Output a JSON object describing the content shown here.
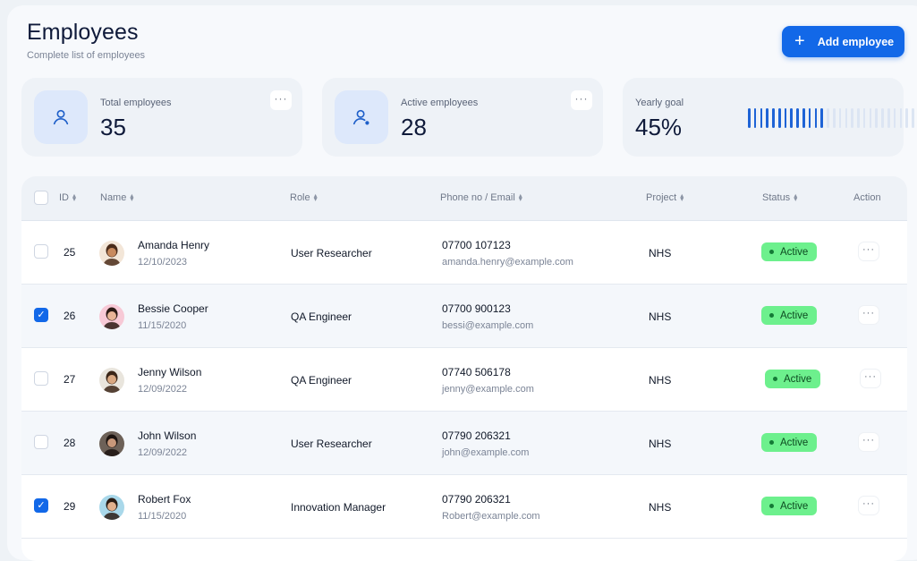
{
  "header": {
    "title": "Employees",
    "subtitle": "Complete list of employees",
    "add_button_label": "Add employee"
  },
  "stats": {
    "total": {
      "label": "Total employees",
      "value": "35",
      "icon": "user-icon"
    },
    "active": {
      "label": "Active employees",
      "value": "28",
      "icon": "user-check-icon"
    },
    "goal": {
      "label": "Yearly goal",
      "value": "45%",
      "progress": 0.45
    }
  },
  "table": {
    "columns": {
      "id": "ID",
      "name": "Name",
      "role": "Role",
      "contact": "Phone no / Email",
      "project": "Project",
      "status": "Status",
      "action": "Action"
    },
    "rows": [
      {
        "id": "25",
        "name": "Amanda Henry",
        "date": "12/10/2023",
        "role": "User Researcher",
        "phone": "07700 107123",
        "email": "amanda.henry@example.com",
        "project": "NHS",
        "status": "Active",
        "checked": false
      },
      {
        "id": "26",
        "name": "Bessie Cooper",
        "date": "11/15/2020",
        "role": "QA Engineer",
        "phone": "07700 900123",
        "email": "bessi@example.com",
        "project": "NHS",
        "status": "Active",
        "checked": true
      },
      {
        "id": "27",
        "name": "Jenny Wilson",
        "date": "12/09/2022",
        "role": "QA Engineer",
        "phone": "07740 506178",
        "email": "jenny@example.com",
        "project": "NHS",
        "status": "Active",
        "checked": false
      },
      {
        "id": "28",
        "name": "John Wilson",
        "date": "12/09/2022",
        "role": "User Researcher",
        "phone": "07790 206321",
        "email": "john@example.com",
        "project": "NHS",
        "status": "Active",
        "checked": false
      },
      {
        "id": "29",
        "name": "Robert Fox",
        "date": "11/15/2020",
        "role": "Innovation Manager",
        "phone": "07790 206321",
        "email": "Robert@example.com",
        "project": "NHS",
        "status": "Active",
        "checked": true
      }
    ]
  },
  "colors": {
    "accent": "#1268e8",
    "status_active_bg": "#6df08d",
    "goal_bar_on": "#1e63d6",
    "goal_bar_off": "#dce5f3"
  }
}
